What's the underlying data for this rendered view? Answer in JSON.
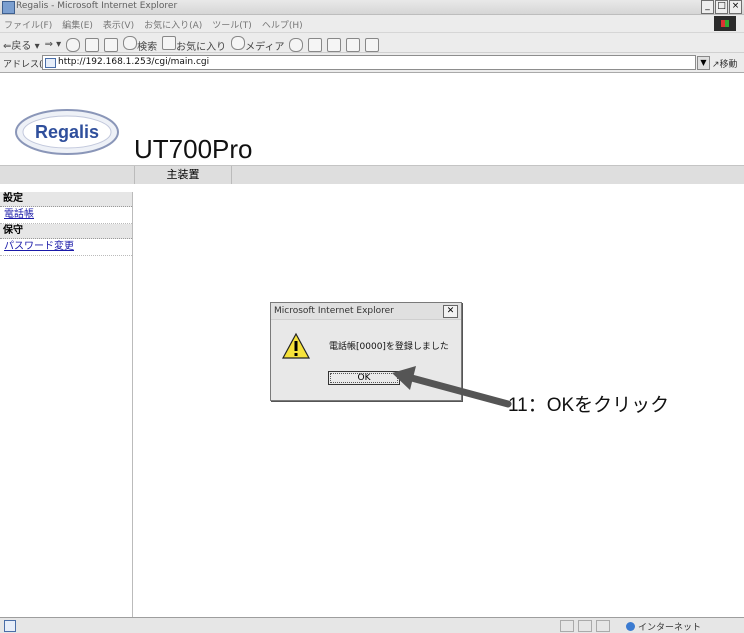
{
  "window": {
    "title": "Regalis - Microsoft Internet Explorer",
    "buttons": [
      "_",
      "□",
      "×"
    ]
  },
  "menubar": {
    "items": [
      "ファイル(F)",
      "編集(E)",
      "表示(V)",
      "お気に入り(A)",
      "ツール(T)",
      "ヘルプ(H)"
    ]
  },
  "toolbar": {
    "back": "戻る",
    "search": "検索",
    "favorites": "お気に入り",
    "media": "メディア"
  },
  "addressbar": {
    "label": "アドレス(D)",
    "url": "http://192.168.1.253/cgi/main.cgi",
    "go": "移動"
  },
  "page": {
    "logo_text": "Regalis",
    "product": "UT700Pro",
    "nav_tab": "主装置",
    "sidebar": [
      {
        "type": "section",
        "label": "設定"
      },
      {
        "type": "link",
        "label": "電話帳"
      },
      {
        "type": "section",
        "label": "保守"
      },
      {
        "type": "link",
        "label": "パスワード変更"
      }
    ]
  },
  "dialog": {
    "title": "Microsoft Internet Explorer",
    "message": "電話帳[0000]を登録しました",
    "ok": "OK"
  },
  "annotation": "11：OKをクリック",
  "statusbar": {
    "zone": "インターネット"
  },
  "colors": {
    "link": "#1a1aa8",
    "logo_blue": "#2f4f9c",
    "arrow": "#555555"
  }
}
